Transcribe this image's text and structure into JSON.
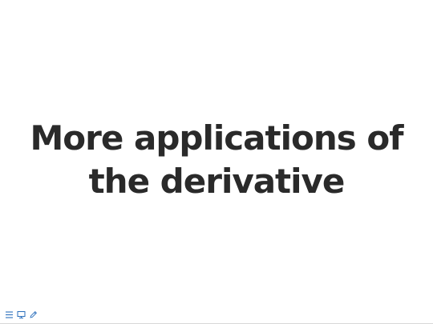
{
  "slide": {
    "title": "More applications of the derivative"
  },
  "controls": {
    "icons": [
      "menu-icon",
      "speaker-notes-icon",
      "pen-icon"
    ],
    "icon_color": "#2a6ebb"
  },
  "colors": {
    "background": "#ffffff",
    "title_text": "#2a2a2a"
  }
}
